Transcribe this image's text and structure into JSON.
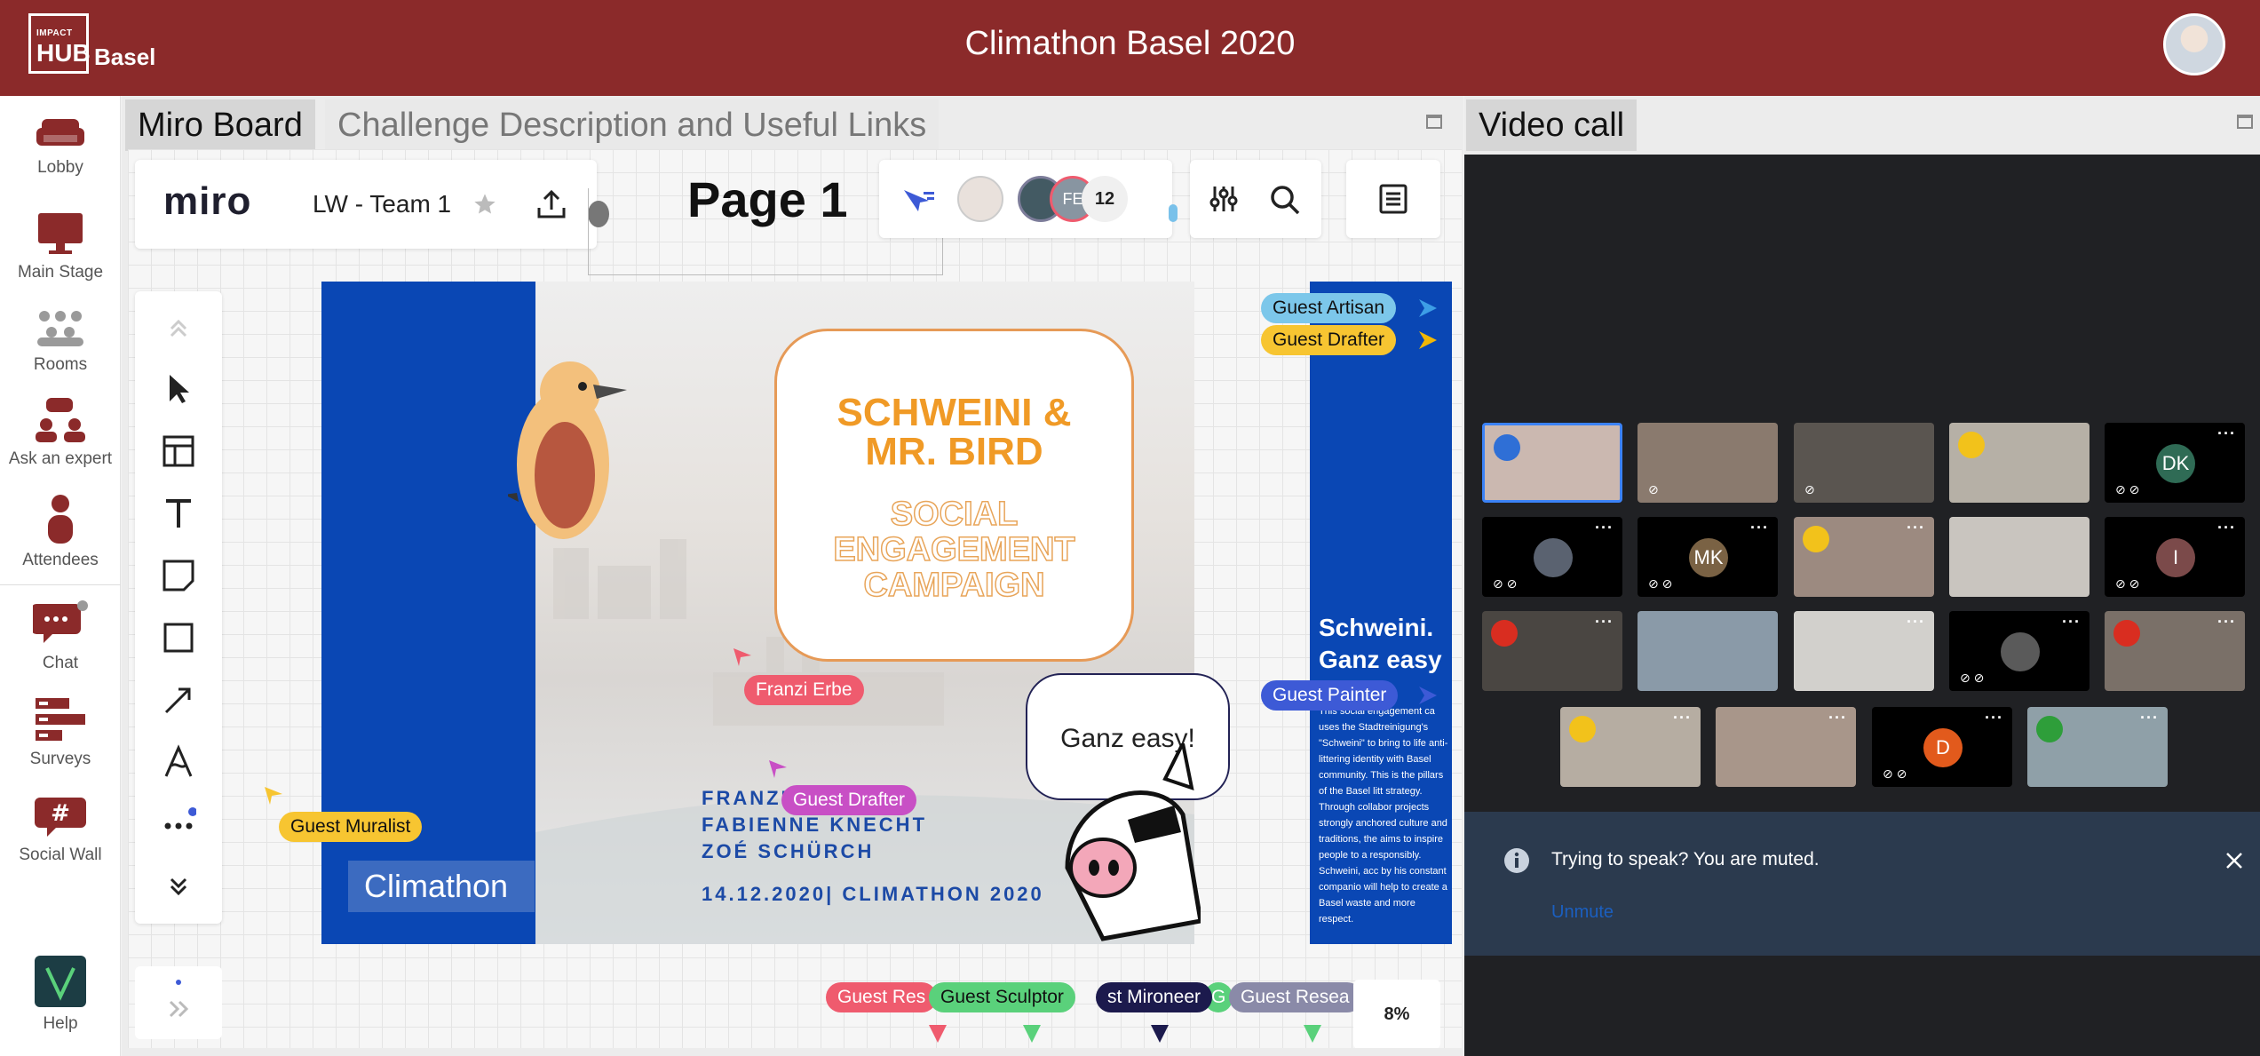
{
  "header": {
    "logo_line1": "IMPACT",
    "logo_line2": "HUB",
    "logo_line3": "Basel",
    "title": "Climathon Basel 2020"
  },
  "sidebar": {
    "items": [
      {
        "label": "Lobby",
        "icon": "sofa-icon"
      },
      {
        "label": "Main Stage",
        "icon": "monitor-icon"
      },
      {
        "label": "Rooms",
        "icon": "group-icon"
      },
      {
        "label": "Ask an expert",
        "icon": "expert-icon"
      },
      {
        "label": "Attendees",
        "icon": "person-icon"
      },
      {
        "label": "Chat",
        "icon": "chat-icon"
      },
      {
        "label": "Surveys",
        "icon": "survey-icon"
      },
      {
        "label": "Social Wall",
        "icon": "hashtag-icon"
      },
      {
        "label": "Help",
        "icon": "help-logo-icon"
      }
    ]
  },
  "main": {
    "tabs": [
      {
        "label": "Miro Board"
      },
      {
        "label": "Challenge Description and Useful Links"
      }
    ]
  },
  "miro": {
    "logo": "miro",
    "board_name": "LW - Team 1",
    "page_title": "Page 1",
    "collaborator_initials": "FE",
    "collaborator_count": "12",
    "zoom": "8%"
  },
  "slide": {
    "title_line1": "SCHWEINI &",
    "title_line2": "MR. BIRD",
    "sub_line1": "SOCIAL",
    "sub_line2": "ENGAGEMENT",
    "sub_line3": "CAMPAIGN",
    "speech": "Ganz easy!",
    "credit1": "FRANZI ERBE",
    "credit2": "FABIENNE KNECHT",
    "credit3": "ZOÉ SCHÜRCH",
    "date": "14.12.2020| CLIMATHON 2020",
    "brand_box": "Climathon"
  },
  "slide2": {
    "heading_line1": "Schweini.",
    "heading_line2": "Ganz easy",
    "body": "This social engagement ca uses the Stadtreinigung's \"Schweini\" to bring to life anti-littering identity with Basel community. This is the pillars of the Basel litt strategy. Through collabor projects strongly anchored culture and traditions, the aims to inspire people to a responsibly. Schweini, acc by his constant companio will help to create a Basel waste and more respect."
  },
  "cursors": [
    {
      "label": "Guest Artisan",
      "color": "#7cc7ea"
    },
    {
      "label": "Guest Drafter",
      "color": "#f7c531"
    },
    {
      "label": "Franzi Erbe",
      "color": "#ef5b6e"
    },
    {
      "label": "Guest Drafter",
      "color": "#c84fc5"
    },
    {
      "label": "Guest Painter",
      "color": "#3d5ad6"
    },
    {
      "label": "Guest Muralist",
      "color": "#f7c531"
    },
    {
      "label": "Guest Res",
      "color": "#ef5b6e"
    },
    {
      "label": "Guest Sculptor",
      "color": "#5ad17b"
    },
    {
      "label": "st Mironeer",
      "color": "#1c1a4d"
    },
    {
      "label": "G",
      "color": "#5ad17b"
    },
    {
      "label": "Guest Resea",
      "color": "#8a8aa8"
    }
  ],
  "video": {
    "title": "Video call",
    "tiles": [
      {
        "initials": "DK",
        "color": "#2f6b55"
      },
      {
        "initials": "MK",
        "color": "#7a6244"
      },
      {
        "initials": "I",
        "color": "#7b4a4a"
      },
      {
        "initials": "D",
        "color": "#e25a1c"
      }
    ],
    "banner_message": "Trying to speak? You are muted.",
    "banner_link": "Unmute"
  },
  "colors": {
    "brand": "#8b2a2a",
    "slide_blue": "#0a47b4",
    "bird_orange": "#f09a26"
  }
}
